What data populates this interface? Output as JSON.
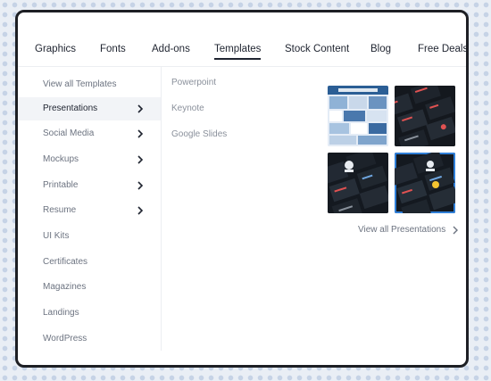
{
  "nav": {
    "items": [
      {
        "label": "Graphics"
      },
      {
        "label": "Fonts"
      },
      {
        "label": "Add-ons"
      },
      {
        "label": "Templates",
        "active": true
      },
      {
        "label": "Stock Content"
      },
      {
        "label": "Blog"
      },
      {
        "label": "Free Deals"
      }
    ]
  },
  "sidebar": {
    "items": [
      {
        "label": "View all Templates"
      },
      {
        "label": "Presentations",
        "active": true,
        "has_submenu": true
      },
      {
        "label": "Social Media",
        "has_submenu": true
      },
      {
        "label": "Mockups",
        "has_submenu": true
      },
      {
        "label": "Printable",
        "has_submenu": true
      },
      {
        "label": "Resume",
        "has_submenu": true
      },
      {
        "label": "UI Kits"
      },
      {
        "label": "Certificates"
      },
      {
        "label": "Magazines"
      },
      {
        "label": "Landings"
      },
      {
        "label": "WordPress"
      }
    ]
  },
  "submenu": {
    "items": [
      {
        "label": "Powerpoint"
      },
      {
        "label": "Keynote"
      },
      {
        "label": "Google Slides"
      }
    ]
  },
  "preview": {
    "view_all_label": "View all Presentations"
  },
  "colors": {
    "accent_text": "#1f2430",
    "muted_text": "#6c7380",
    "page_background": "#e9eef5"
  }
}
